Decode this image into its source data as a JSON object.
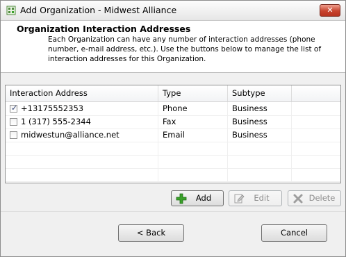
{
  "window": {
    "title": "Add Organization - Midwest Alliance",
    "close_glyph": "✕",
    "icon": "organization-add-icon"
  },
  "header": {
    "title": "Organization Interaction Addresses",
    "description": "Each Organization can have any number of interaction addresses (phone number, e-mail address, etc.).  Use the buttons below to manage the list of interaction addresses for this Organization."
  },
  "table": {
    "columns": [
      "Interaction Address",
      "Type",
      "Subtype",
      ""
    ],
    "rows": [
      {
        "address": "+13175552353",
        "type": "Phone",
        "subtype": "Business",
        "checked": true
      },
      {
        "address": "1 (317) 555-2344",
        "type": "Fax",
        "subtype": "Business",
        "checked": false
      },
      {
        "address": "midwestun@alliance.net",
        "type": "Email",
        "subtype": "Business",
        "checked": false
      }
    ],
    "check_glyph": "✓"
  },
  "actions": {
    "add": "Add",
    "edit": "Edit",
    "delete": "Delete"
  },
  "footer": {
    "back": "< Back",
    "cancel": "Cancel"
  },
  "colors": {
    "add_icon": "#3aa12a",
    "disabled_icon": "#a0a0a0"
  }
}
